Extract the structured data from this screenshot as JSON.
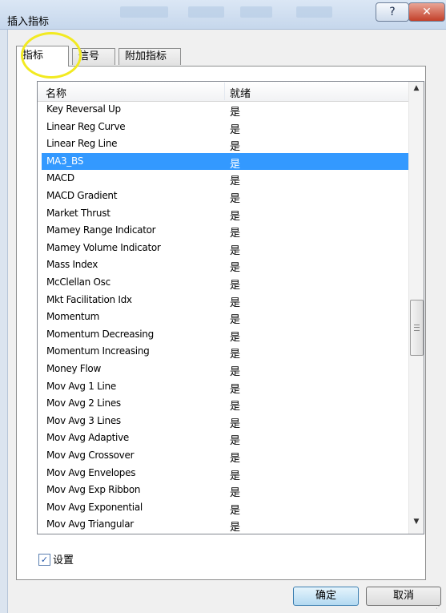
{
  "window": {
    "title": "插入指标",
    "help_glyph": "?",
    "close_glyph": "✕"
  },
  "tabs": [
    {
      "label": "指标"
    },
    {
      "label": "信号"
    },
    {
      "label": "附加指标"
    }
  ],
  "list": {
    "columns": {
      "name": "名称",
      "ready": "就绪"
    },
    "selected": "MA3_BS",
    "rows": [
      {
        "name": "Key Reversal Up",
        "ready": "是"
      },
      {
        "name": "Linear Reg Curve",
        "ready": "是"
      },
      {
        "name": "Linear Reg Line",
        "ready": "是"
      },
      {
        "name": "MA3_BS",
        "ready": "是"
      },
      {
        "name": "MACD",
        "ready": "是"
      },
      {
        "name": "MACD Gradient",
        "ready": "是"
      },
      {
        "name": "Market Thrust",
        "ready": "是"
      },
      {
        "name": "Mamey Range Indicator",
        "ready": "是"
      },
      {
        "name": "Mamey Volume Indicator",
        "ready": "是"
      },
      {
        "name": "Mass Index",
        "ready": "是"
      },
      {
        "name": "McClellan Osc",
        "ready": "是"
      },
      {
        "name": "Mkt Facilitation Idx",
        "ready": "是"
      },
      {
        "name": "Momentum",
        "ready": "是"
      },
      {
        "name": "Momentum Decreasing",
        "ready": "是"
      },
      {
        "name": "Momentum Increasing",
        "ready": "是"
      },
      {
        "name": "Money Flow",
        "ready": "是"
      },
      {
        "name": "Mov Avg 1 Line",
        "ready": "是"
      },
      {
        "name": "Mov Avg 2 Lines",
        "ready": "是"
      },
      {
        "name": "Mov Avg 3 Lines",
        "ready": "是"
      },
      {
        "name": "Mov Avg Adaptive",
        "ready": "是"
      },
      {
        "name": "Mov Avg Crossover",
        "ready": "是"
      },
      {
        "name": "Mov Avg Envelopes",
        "ready": "是"
      },
      {
        "name": "Mov Avg Exp Ribbon",
        "ready": "是"
      },
      {
        "name": "Mov Avg Exponential",
        "ready": "是"
      },
      {
        "name": "Mov Avg Triangular",
        "ready": "是"
      }
    ]
  },
  "settings_checkbox": {
    "label": "设置",
    "checked": true,
    "check_glyph": "✓"
  },
  "buttons": {
    "ok": "确定",
    "cancel": "取消"
  },
  "scrollbar": {
    "up_glyph": "▲",
    "down_glyph": "▼"
  },
  "colors": {
    "selection": "#3399ff",
    "highlight_circle": "#f2ea21"
  }
}
